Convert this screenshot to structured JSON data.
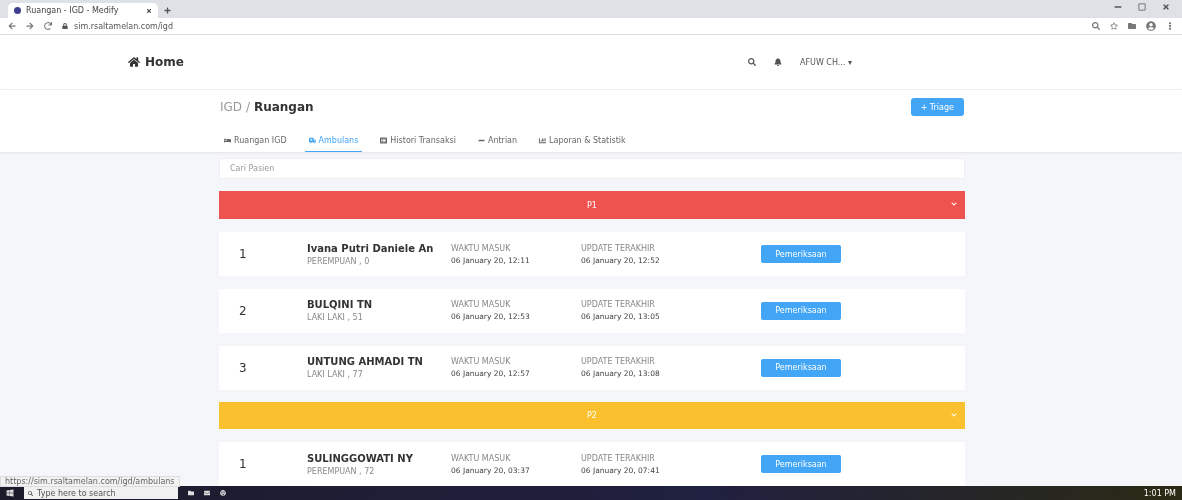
{
  "browser": {
    "tab_title": "Ruangan - IGD - Medify",
    "url": "sim.rsaltamelan.com/igd",
    "status_url": "https://sim.rsaltamelan.com/igd/ambulans"
  },
  "navbar": {
    "home": "Home",
    "user": "AFUW CH... ▾"
  },
  "header": {
    "breadcrumb_parent": "IGD /",
    "breadcrumb_current": "Ruangan",
    "triage_button": "+ Triage"
  },
  "tabs": [
    {
      "label": "Ruangan IGD",
      "selected": false
    },
    {
      "label": "Ambulans",
      "selected": true
    },
    {
      "label": "Histori Transaksi",
      "selected": false
    },
    {
      "label": "Antrian",
      "selected": false
    },
    {
      "label": "Laporan & Statistik",
      "selected": false
    }
  ],
  "search": {
    "placeholder": "Cari Pasien"
  },
  "groups": [
    {
      "label": "P1",
      "color": "#ef5350",
      "rows": [
        {
          "number": "1",
          "name": "Ivana Putri Daniele An",
          "detail": "PEREMPUAN , 0",
          "in_label": "WAKTU MASUK",
          "in_time": "06 January 20, 12:11",
          "update_label": "UPDATE TERAKHIR",
          "update_time": "06 January 20, 12:52",
          "button": "Pemeriksaan"
        },
        {
          "number": "2",
          "name": "BULQINI TN",
          "detail": "LAKI LAKI , 51",
          "in_label": "WAKTU MASUK",
          "in_time": "06 January 20, 12:53",
          "update_label": "UPDATE TERAKHIR",
          "update_time": "06 January 20, 13:05",
          "button": "Pemeriksaan"
        },
        {
          "number": "3",
          "name": "UNTUNG AHMADI TN",
          "detail": "LAKI LAKI , 77",
          "in_label": "WAKTU MASUK",
          "in_time": "06 January 20, 12:57",
          "update_label": "UPDATE TERAKHIR",
          "update_time": "06 January 20, 13:08",
          "button": "Pemeriksaan"
        }
      ]
    },
    {
      "label": "P2",
      "color": "#fbc02d",
      "rows": [
        {
          "number": "1",
          "name": "SULINGGOWATI NY",
          "detail": "PEREMPUAN , 72",
          "in_label": "WAKTU MASUK",
          "in_time": "06 January 20, 03:37",
          "update_label": "UPDATE TERAKHIR",
          "update_time": "06 January 20, 07:41",
          "button": "Pemeriksaan"
        }
      ]
    }
  ],
  "taskbar": {
    "search_placeholder": "Type here to search",
    "time": "1:01 PM"
  }
}
